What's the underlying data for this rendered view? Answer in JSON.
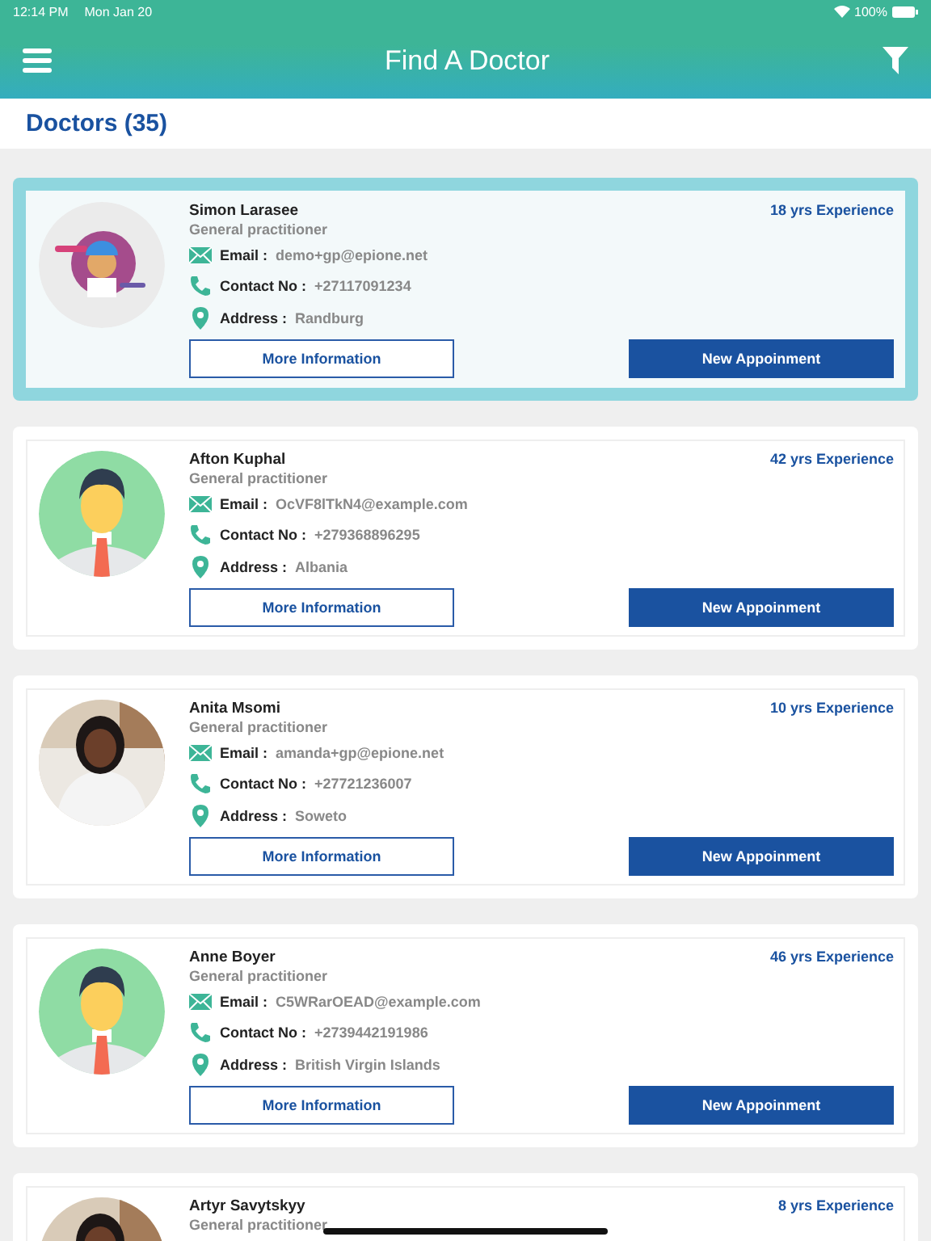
{
  "status_bar": {
    "time": "12:14 PM",
    "date": "Mon Jan 20",
    "battery": "100%"
  },
  "header": {
    "title": "Find A Doctor"
  },
  "list_title": "Doctors (35)",
  "doctors": [
    {
      "name": "Simon Larasee",
      "specialty": "General practitioner",
      "experience": "18 yrs Experience",
      "selected": true,
      "kind": "cartoon",
      "email_label": "Email :",
      "email": "demo+gp@epione.net",
      "contact_label": "Contact No :",
      "contact": "+27117091234",
      "address_label": "Address :",
      "address": "Randburg",
      "more_button": "More Information",
      "appointment_button": "New Appoinment"
    },
    {
      "name": "Afton Kuphal",
      "specialty": "General practitioner",
      "experience": "42 yrs Experience",
      "selected": false,
      "kind": "male",
      "email_label": "Email :",
      "email": "OcVF8lTkN4@example.com",
      "contact_label": "Contact No :",
      "contact": "+279368896295",
      "address_label": "Address :",
      "address": "Albania",
      "more_button": "More Information",
      "appointment_button": "New Appoinment"
    },
    {
      "name": "Anita Msomi",
      "specialty": "General practitioner",
      "experience": "10 yrs Experience",
      "selected": false,
      "kind": "picture",
      "email_label": "Email :",
      "email": "amanda+gp@epione.net",
      "contact_label": "Contact No :",
      "contact": "+27721236007",
      "address_label": "Address :",
      "address": "Soweto",
      "more_button": "More Information",
      "appointment_button": "New Appoinment"
    },
    {
      "name": "Anne Boyer",
      "specialty": "General practitioner",
      "experience": "46 yrs Experience",
      "selected": false,
      "kind": "male",
      "email_label": "Email :",
      "email": "C5WRarOEAD@example.com",
      "contact_label": "Contact No :",
      "contact": "+2739442191986",
      "address_label": "Address :",
      "address": "British Virgin Islands",
      "more_button": "More Information",
      "appointment_button": "New Appoinment"
    },
    {
      "name": "Artyr Savytskyy",
      "specialty": "General practitioner",
      "experience": "8 yrs Experience",
      "selected": false,
      "kind": "picture"
    }
  ]
}
